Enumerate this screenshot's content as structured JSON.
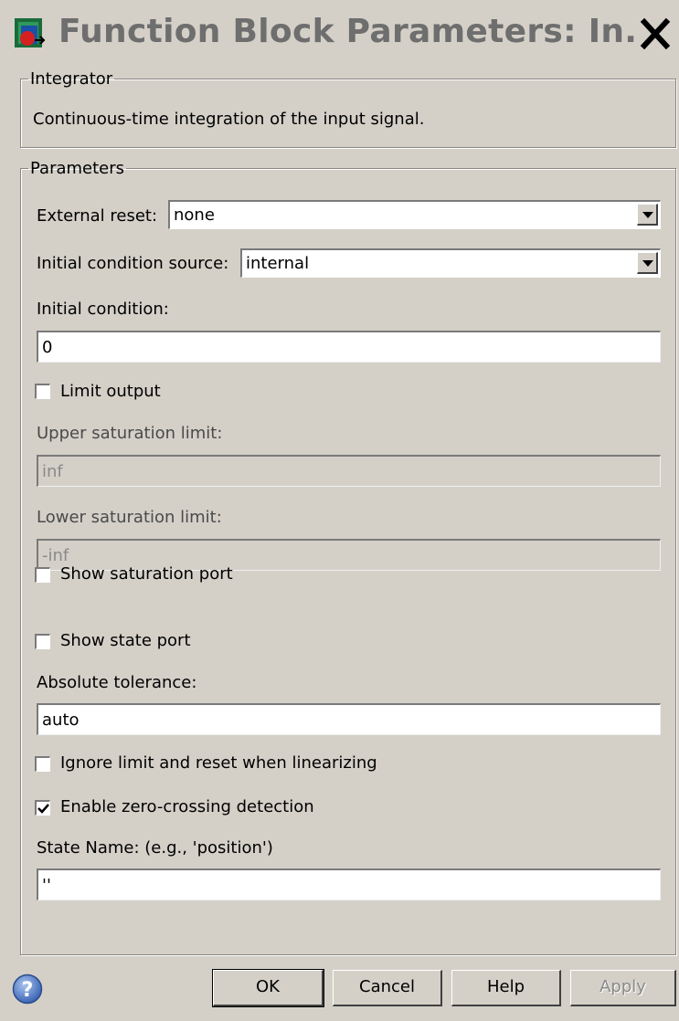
{
  "window": {
    "title": "Function Block Parameters: In..."
  },
  "block_group": {
    "legend": "Integrator",
    "description": "Continuous-time integration of the input signal."
  },
  "parameters": {
    "legend": "Parameters",
    "external_reset": {
      "label": "External reset:",
      "value": "none"
    },
    "ic_source": {
      "label": "Initial condition source:",
      "value": "internal"
    },
    "initial_condition": {
      "label": "Initial condition:",
      "value": "0"
    },
    "limit_output": {
      "label": "Limit output",
      "checked": false
    },
    "upper_limit": {
      "label": "Upper saturation limit:",
      "value": "inf"
    },
    "lower_limit": {
      "label": "Lower saturation limit:",
      "value": "-inf"
    },
    "show_saturation_port": {
      "label": "Show saturation port",
      "checked": false
    },
    "show_state_port": {
      "label": "Show state port",
      "checked": false
    },
    "absolute_tolerance": {
      "label": "Absolute tolerance:",
      "value": "auto"
    },
    "ignore_limit": {
      "label": "Ignore limit and reset when linearizing",
      "checked": false
    },
    "zero_crossing": {
      "label": "Enable zero-crossing detection",
      "checked": true
    },
    "state_name": {
      "label": "State Name: (e.g., 'position')",
      "value": "''"
    }
  },
  "buttons": {
    "ok": "OK",
    "cancel": "Cancel",
    "help": "Help",
    "apply": "Apply"
  },
  "icons": {
    "app": "simulink-block-icon",
    "close": "close-icon",
    "help": "help-question-icon",
    "checkmark": "checkmark-icon"
  },
  "colors": {
    "dialog_bg": "#d4d0c8",
    "title_text": "#6e6e6e",
    "help_icon": "#3b64b4"
  }
}
